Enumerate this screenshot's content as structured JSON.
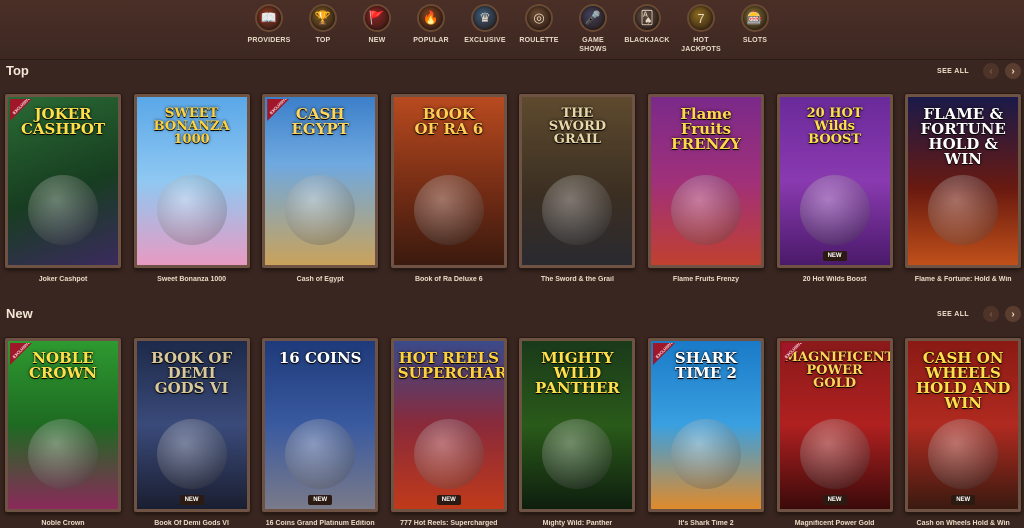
{
  "nav": {
    "items": [
      {
        "label": "PROVIDERS",
        "icon": "providers-icon",
        "glyph": "📖",
        "color": "#8a3b26"
      },
      {
        "label": "TOP",
        "icon": "top-icon",
        "glyph": "🏆",
        "color": "#7a5a24"
      },
      {
        "label": "NEW",
        "icon": "new-icon",
        "glyph": "🚩",
        "color": "#8a2424"
      },
      {
        "label": "POPULAR",
        "icon": "popular-icon",
        "glyph": "🔥",
        "color": "#7a4020"
      },
      {
        "label": "EXCLUSIVE",
        "icon": "exclusive-icon",
        "glyph": "♛",
        "color": "#3a5a78"
      },
      {
        "label": "ROULETTE",
        "icon": "roulette-icon",
        "glyph": "◎",
        "color": "#6a4a30"
      },
      {
        "label": "GAME SHOWS",
        "icon": "game-shows-icon",
        "glyph": "🎤",
        "color": "#40405a"
      },
      {
        "label": "BLACKJACK",
        "icon": "blackjack-icon",
        "glyph": "🂡",
        "color": "#5a4a40"
      },
      {
        "label": "HOT JACKPOTS",
        "icon": "hot-jackpots-icon",
        "glyph": "7",
        "color": "#8a6a20"
      },
      {
        "label": "SLOTS",
        "icon": "slots-icon",
        "glyph": "🎰",
        "color": "#7a6a30"
      }
    ]
  },
  "sections": {
    "top": {
      "title": "Top",
      "see_all": "SEE ALL",
      "prev": "‹",
      "next": "›"
    },
    "new": {
      "title": "New",
      "see_all": "SEE ALL",
      "prev": "‹",
      "next": "›"
    }
  },
  "top_games": [
    {
      "name": "Joker Cashpot",
      "art": "JOKER\nCASHPOT",
      "bg": "linear-gradient(160deg,#2a6b35,#173d20 55%,#3b2a5e)",
      "tc": "#ffe04a",
      "exclusive": true,
      "new": false
    },
    {
      "name": "Sweet Bonanza 1000",
      "art": "SWEET\nBONANZA\n1000",
      "bg": "linear-gradient(180deg,#5aa7e8,#8fc8f2 50%,#e89ac2)",
      "tc": "#ffd23a",
      "exclusive": false,
      "new": false
    },
    {
      "name": "Cash of Egypt",
      "art": "CASH\nEGYPT",
      "bg": "linear-gradient(180deg,#3c7fc9,#6fa9e0 40%,#c9a25a)",
      "tc": "#ffd65a",
      "exclusive": true,
      "new": false
    },
    {
      "name": "Book of Ra Deluxe 6",
      "art": "BOOK\nOF RA 6",
      "bg": "linear-gradient(180deg,#b84a1f,#6e2a14 60%,#3a1a0e)",
      "tc": "#ffcc55",
      "exclusive": false,
      "new": false
    },
    {
      "name": "The Sword & the Grail",
      "art": "THE\nSWORD\nGRAIL",
      "bg": "linear-gradient(180deg,#5e4a2e,#3a2e22 60%,#2a2a30)",
      "tc": "#e8d7a8",
      "exclusive": false,
      "new": false
    },
    {
      "name": "Flame Fruits Frenzy",
      "art": "Flame Fruits\nFRENZY",
      "bg": "linear-gradient(180deg,#7a2a8a,#a0307a 50%,#c04030)",
      "tc": "#ffd84a",
      "exclusive": false,
      "new": false
    },
    {
      "name": "20 Hot Wilds Boost",
      "art": "20 HOT\nWilds\nBOOST",
      "bg": "linear-gradient(180deg,#6a2a9a,#8a3ab0 50%,#4a1a6a)",
      "tc": "#ffe04a",
      "exclusive": false,
      "new": true
    },
    {
      "name": "Flame & Fortune: Hold & Win",
      "art": "FLAME & FORTUNE\nHOLD & WIN",
      "bg": "linear-gradient(180deg,#1a1a4a,#6a1a10 55%,#c0501a)",
      "tc": "#ffffff",
      "exclusive": false,
      "new": false
    }
  ],
  "new_games": [
    {
      "name": "Noble Crown",
      "art": "NOBLE\nCROWN",
      "bg": "linear-gradient(180deg,#2e9a30,#1e6a22 50%,#8a2a5a)",
      "tc": "#ffe04a",
      "exclusive": true,
      "new": false
    },
    {
      "name": "Book Of Demi Gods VI",
      "art": "BOOK OF\nDEMI GODS VI",
      "bg": "linear-gradient(180deg,#1e2a4a,#3a4a7a 50%,#1a1e30)",
      "tc": "#d8c89a",
      "exclusive": false,
      "new": true
    },
    {
      "name": "16 Coins Grand Platinum Edition",
      "art": "16 COINS",
      "bg": "linear-gradient(180deg,#1e3a7a,#3a5aa0 50%,#7a7a8a)",
      "tc": "#ffffff",
      "exclusive": false,
      "new": true
    },
    {
      "name": "777 Hot Reels: Supercharged",
      "art": "HOT REELS\nSUPERCHARGED",
      "bg": "linear-gradient(180deg,#3a4a8a,#8a2a3a 50%,#c03a1a)",
      "tc": "#ffd23a",
      "exclusive": false,
      "new": true
    },
    {
      "name": "Mighty Wild: Panther",
      "art": "MIGHTY WILD\nPANTHER",
      "bg": "linear-gradient(180deg,#1a3a1a,#2a5a1a 50%,#0e1e0e)",
      "tc": "#ffe04a",
      "exclusive": false,
      "new": false
    },
    {
      "name": "It's Shark Time 2",
      "art": "SHARK\nTIME 2",
      "bg": "linear-gradient(180deg,#1a7ac8,#3aa0e0 50%,#e08a2a)",
      "tc": "#ffffff",
      "exclusive": true,
      "new": false
    },
    {
      "name": "Magnificent Power Gold",
      "art": "MAGNIFICENT\nPOWER\nGOLD",
      "bg": "linear-gradient(180deg,#8a1a1a,#b02020 50%,#3a0a0a)",
      "tc": "#ffd65a",
      "exclusive": true,
      "new": true
    },
    {
      "name": "Cash on Wheels Hold & Win",
      "art": "CASH ON WHEELS\nHOLD AND WIN",
      "bg": "linear-gradient(180deg,#8a1a14,#b02a20 50%,#3a1a10)",
      "tc": "#ffe04a",
      "exclusive": false,
      "new": true
    }
  ],
  "badges": {
    "exclusive": "EXCLUSIVE",
    "new": "NEW"
  }
}
